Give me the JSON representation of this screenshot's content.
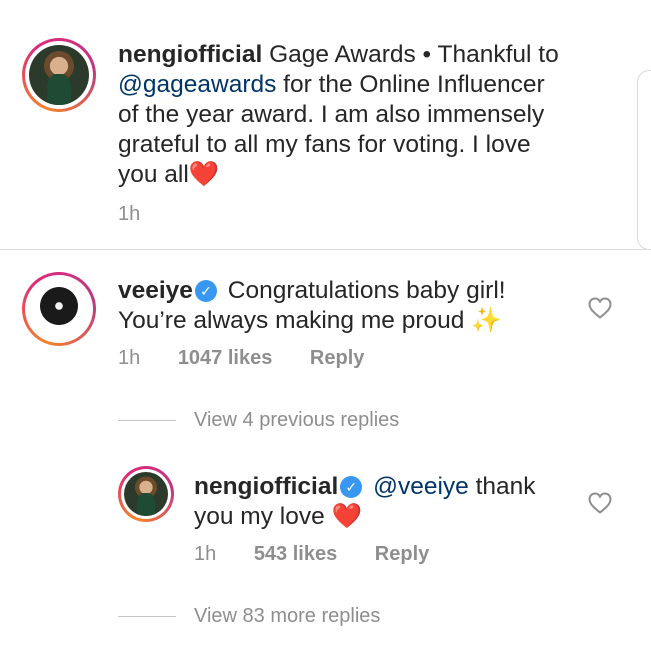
{
  "caption": {
    "username": "nengiofficial",
    "text_1": " Gage Awards • Thankful to",
    "mention": "@gageawards",
    "text_2": " for the Online Influencer",
    "text_3": "of the year award. I am also immensely",
    "text_4": "grateful to all my fans for voting. I love",
    "text_5": "you all",
    "emoji": "❤️",
    "time": "1h"
  },
  "comment": {
    "username": "veeiye",
    "verified_mark": "✓",
    "text_1": "Congratulations baby girl!",
    "text_2": "You’re always making me proud",
    "emoji": "✨",
    "time": "1h",
    "likes": "1047 likes",
    "reply": "Reply"
  },
  "view_previous": "View 4 previous replies",
  "reply": {
    "username": "nengiofficial",
    "verified_mark": "✓",
    "mention": "@veeiye",
    "text_1": " thank",
    "text_2": "you my love",
    "emoji": "❤️",
    "time": "1h",
    "likes": "543 likes",
    "reply": "Reply"
  },
  "view_more": "View 83 more replies",
  "icons": {
    "caption_avatar": "profile-photo",
    "comment_avatar": "profile-photo",
    "reply_avatar": "profile-photo",
    "like": "heart-outline-icon"
  }
}
